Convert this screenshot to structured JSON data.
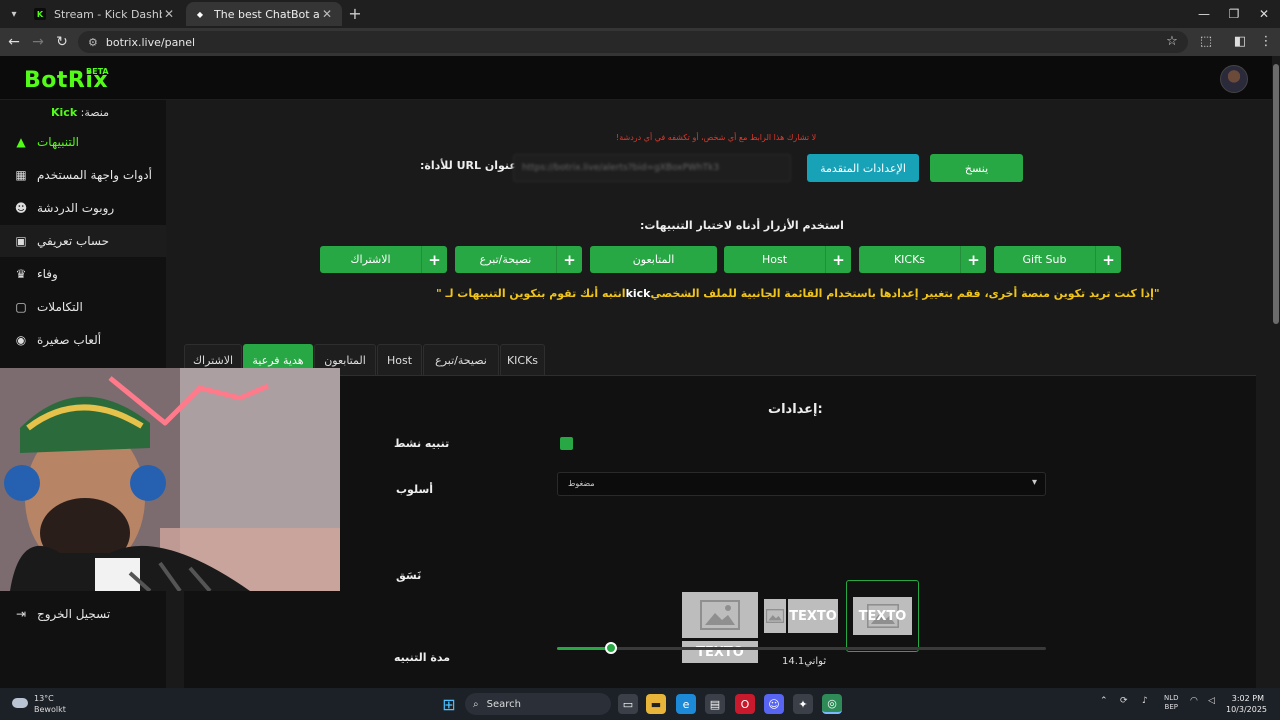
{
  "browser": {
    "tabs": [
      {
        "title": "Stream - Kick Dashboard",
        "favicon": "K",
        "color": "#53fc18"
      },
      {
        "title": "The best ChatBot and Widgets",
        "favicon": "◆",
        "color": "#ffffff"
      }
    ],
    "new_tab": "+",
    "url": "botrix.live/panel",
    "window": {
      "minimize": "—",
      "restore": "❐",
      "close": "✕"
    }
  },
  "app": {
    "logo": "BotRix",
    "beta": "BETA",
    "platform_label": "منصة:",
    "platform_value": "Kick"
  },
  "sidebar": {
    "items": [
      {
        "label": "التنبيهات",
        "icon": "warning-icon",
        "glyph": "▲"
      },
      {
        "label": "أدوات واجهة المستخدم",
        "icon": "widgets-icon",
        "glyph": "▦"
      },
      {
        "label": "روبوت الدردشة",
        "icon": "robot-icon",
        "glyph": "☻"
      },
      {
        "label": "حساب تعريفي",
        "icon": "profile-card-icon",
        "glyph": "▣"
      },
      {
        "label": "وفاء",
        "icon": "trophy-icon",
        "glyph": "♛"
      },
      {
        "label": "التكاملات",
        "icon": "integrations-icon",
        "glyph": "▢"
      },
      {
        "label": "ألعاب صغيرة",
        "icon": "gamepad-icon",
        "glyph": "◉"
      }
    ],
    "logout": {
      "label": "تسجيل الخروج",
      "glyph": "⇥"
    }
  },
  "alerts": {
    "warning": "لا تشارك هذا الرابط مع أي شخص، أو تكشفه في أي دردشة!",
    "url_label": "عنوان URL للأداة:",
    "url_value": "https://botrix.live/alerts?bid=gXBoxPWhTk3",
    "advanced_button": "الإعدادات المتقدمة",
    "copy_button": "ينسخ",
    "test_hint": "استخدم الأزرار أدناه لاختبار التنبيهات:",
    "test_buttons": [
      {
        "label": "Gift Sub",
        "plus": true
      },
      {
        "label": "KICKs",
        "plus": true
      },
      {
        "label": "Host",
        "plus": true
      },
      {
        "label": "المتابعون",
        "plus": false
      },
      {
        "label": "نصيحة/تبرع",
        "plus": true
      },
      {
        "label": "الاشتراك",
        "plus": true
      }
    ],
    "note_pre": "\"إذا كنت تريد تكوين منصة أخرى، فقم بتغيير إعدادها باستخدام القائمة الجانبية للملف الشخصي",
    "note_platform": "kick",
    "note_post": "انتبه أنك تقوم بتكوين التنبيهات لـ \"",
    "tabs": [
      "KICKs",
      "نصيحة/تبرع",
      "Host",
      "المتابعون",
      "هدية فرعية",
      "الاشتراك"
    ],
    "active_tab": "هدية فرعية"
  },
  "settings": {
    "title": "إعدادات:",
    "active_alert_label": "تنبيه نشط",
    "active_alert_checked": true,
    "style_label": "أسلوب",
    "style_value": "مضغوط",
    "layout_label": "نَسَق",
    "layout_text": "TEXTO",
    "duration_label": "مدة التنبيه",
    "duration_value": "14.1ثواني",
    "duration_fraction": 0.11
  },
  "taskbar": {
    "temp": "13°C",
    "weather": "Bewolkt",
    "search": "Search",
    "lang_top": "NLD",
    "lang_bottom": "BEP",
    "time": "3:02 PM",
    "date": "10/3/2025"
  }
}
